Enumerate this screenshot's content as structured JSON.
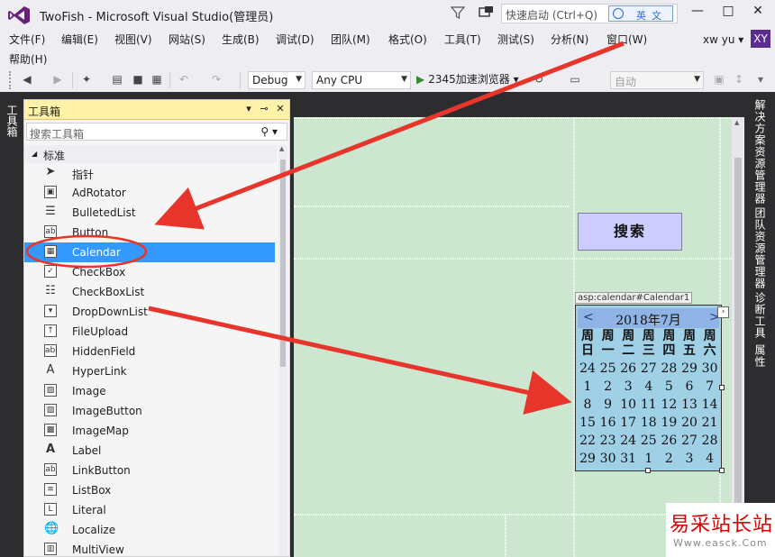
{
  "window": {
    "title": "TwoFish - Microsoft Visual Studio(管理员)",
    "quick_launch_placeholder": "快速启动 (Ctrl+Q)",
    "ime_badge": "英文",
    "minimize": "—",
    "maximize": "□",
    "close": "✕"
  },
  "menus": [
    "文件(F)",
    "编辑(E)",
    "视图(V)",
    "网站(S)",
    "生成(B)",
    "调试(D)",
    "团队(M)",
    "格式(O)",
    "工具(T)",
    "测试(S)",
    "分析(N)",
    "窗口(W)",
    "帮助(H)"
  ],
  "user": {
    "name": "xw yu",
    "initials": "XY"
  },
  "toolbar": {
    "config": "Debug",
    "platform": "Any CPU",
    "run_target": "2345加速浏览器",
    "zoom": "自动"
  },
  "toolbox": {
    "title": "工具箱",
    "search_placeholder": "搜索工具箱",
    "group": "标准",
    "items": [
      {
        "name": "指针",
        "icon": "pointer-icon"
      },
      {
        "name": "AdRotator",
        "icon": "adrotator-icon"
      },
      {
        "name": "BulletedList",
        "icon": "bulleted-list-icon"
      },
      {
        "name": "Button",
        "icon": "button-icon"
      },
      {
        "name": "Calendar",
        "icon": "calendar-icon",
        "selected": true
      },
      {
        "name": "CheckBox",
        "icon": "checkbox-icon"
      },
      {
        "name": "CheckBoxList",
        "icon": "checkbox-list-icon"
      },
      {
        "name": "DropDownList",
        "icon": "dropdown-list-icon"
      },
      {
        "name": "FileUpload",
        "icon": "file-upload-icon"
      },
      {
        "name": "HiddenField",
        "icon": "hidden-field-icon"
      },
      {
        "name": "HyperLink",
        "icon": "hyperlink-icon"
      },
      {
        "name": "Image",
        "icon": "image-icon"
      },
      {
        "name": "ImageButton",
        "icon": "image-button-icon"
      },
      {
        "name": "ImageMap",
        "icon": "image-map-icon"
      },
      {
        "name": "Label",
        "icon": "label-icon"
      },
      {
        "name": "LinkButton",
        "icon": "link-button-icon"
      },
      {
        "name": "ListBox",
        "icon": "listbox-icon"
      },
      {
        "name": "Literal",
        "icon": "literal-icon"
      },
      {
        "name": "Localize",
        "icon": "localize-icon"
      },
      {
        "name": "MultiView",
        "icon": "multiview-icon"
      }
    ]
  },
  "side_tabs": {
    "left": "工具箱",
    "right": [
      "解决方案资源管理器",
      "团队资源管理器",
      "诊断工具",
      "属性"
    ]
  },
  "designer": {
    "search_button": "搜索",
    "calendar_tag": "asp:calendar#Calendar1",
    "calendar": {
      "prev": "<",
      "next": ">",
      "month": "2018年7月",
      "dow": [
        [
          "周",
          "日"
        ],
        [
          "周",
          "一"
        ],
        [
          "周",
          "二"
        ],
        [
          "周",
          "三"
        ],
        [
          "周",
          "四"
        ],
        [
          "周",
          "五"
        ],
        [
          "周",
          "六"
        ]
      ],
      "weeks": [
        [
          "24",
          "25",
          "26",
          "27",
          "28",
          "29",
          "30"
        ],
        [
          "1",
          "2",
          "3",
          "4",
          "5",
          "6",
          "7"
        ],
        [
          "8",
          "9",
          "10",
          "11",
          "12",
          "13",
          "14"
        ],
        [
          "15",
          "16",
          "17",
          "18",
          "19",
          "20",
          "21"
        ],
        [
          "22",
          "23",
          "24",
          "25",
          "26",
          "27",
          "28"
        ],
        [
          "29",
          "30",
          "31",
          "1",
          "2",
          "3",
          "4"
        ]
      ]
    }
  },
  "watermark": {
    "text": "易采站长站",
    "url": "Www.easck.Com"
  },
  "colors": {
    "selection": "#3399ff",
    "designer_bg": "#cde6cf",
    "calendar_bg": "#9fd0e6",
    "calendar_header": "#8fb3e4",
    "annotation_red": "#e8352b",
    "toolbox_header": "#fff1a8"
  }
}
